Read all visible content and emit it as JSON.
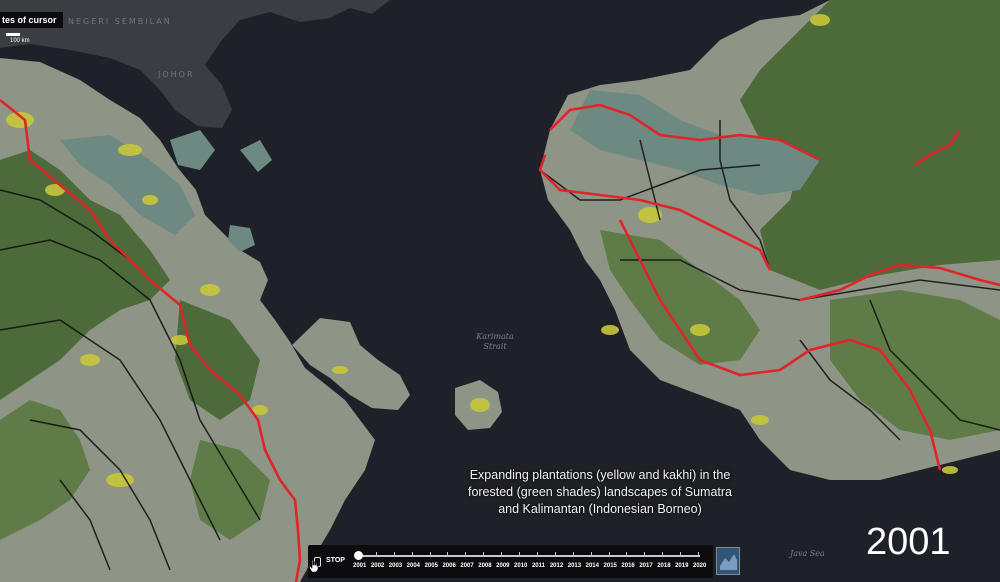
{
  "map": {
    "place_labels": [
      "Negeri Sembilan",
      "Johor"
    ],
    "sea_labels": [
      "Karimata Strait",
      "Java Sea"
    ],
    "colors": {
      "sea": "#1f2128",
      "peninsula_land": "#3b3d42",
      "non_forest": "#8e9486",
      "forest_dark": "#4d6a3a",
      "forest_mid": "#5f7c48",
      "grey_green": "#6d8a82",
      "plantation_yellow": "#c8c63a",
      "road_red": "#e0242a",
      "road_black": "#0d0d0d"
    }
  },
  "coords_box": {
    "label": "tes of cursor"
  },
  "scale": {
    "label": "100 km"
  },
  "caption": {
    "line1": "Expanding plantations (yellow and kakhi) in the",
    "line2": "forested (green shades)  landscapes of Sumatra",
    "line3": "and Kalimantan (Indonesian Borneo)"
  },
  "current_year": "2001",
  "timeline": {
    "play_label": "STOP",
    "years": [
      "2001",
      "2002",
      "2003",
      "2004",
      "2005",
      "2006",
      "2007",
      "2008",
      "2009",
      "2010",
      "2011",
      "2012",
      "2013",
      "2014",
      "2015",
      "2016",
      "2017",
      "2018",
      "2019",
      "2020"
    ],
    "current_index": 0
  }
}
